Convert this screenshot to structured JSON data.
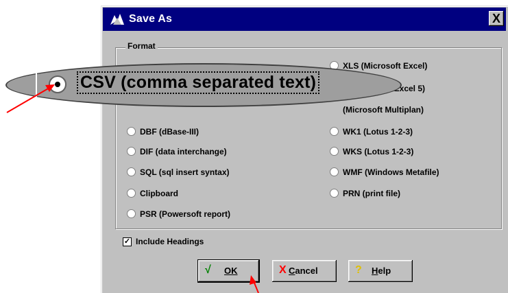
{
  "dialog": {
    "title": "Save As",
    "close_label": "X",
    "group_label": "Format",
    "formats_left": [
      "DBF (dBase-III)",
      "DIF (data interchange)",
      "SQL (sql insert syntax)",
      "Clipboard",
      "PSR (Powersoft report)"
    ],
    "formats_right": [
      "XLS (Microsoft Excel)",
      "osoft Excel 5)",
      "(Microsoft Multiplan)",
      "WK1 (Lotus 1-2-3)",
      "WKS (Lotus 1-2-3)",
      "WMF (Windows Metafile)",
      "PRN (print file)"
    ],
    "zoomed_selected_format": "CSV (comma separated text)",
    "include_headings_label": "Include Headings",
    "include_headings_checked": true,
    "buttons": {
      "ok": {
        "glyph": "√",
        "label": "OK"
      },
      "cancel": {
        "glyph": "X",
        "label": "Cancel",
        "underline_char": "C",
        "rest": "ancel"
      },
      "help": {
        "glyph": "?",
        "label": "Help",
        "underline_char": "H",
        "rest": "elp"
      }
    }
  },
  "colors": {
    "titlebar": "#000080",
    "dialog_face": "#c0c0c0",
    "annotation_arrow": "#ff0000",
    "ok_glyph": "#008000",
    "cancel_glyph": "#ff0000",
    "help_glyph": "#e0c000"
  }
}
